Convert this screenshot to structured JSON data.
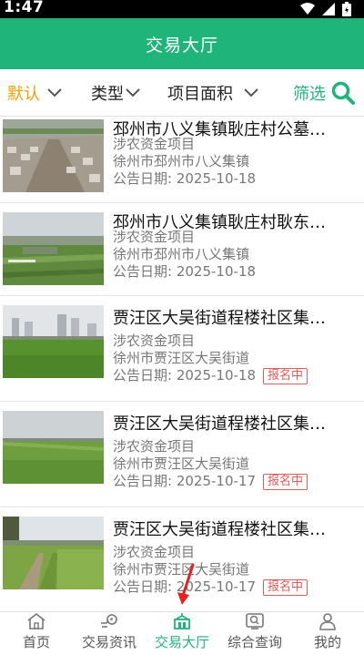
{
  "status": {
    "time": "1:47"
  },
  "header": {
    "title": "交易大厅"
  },
  "filters": {
    "default_label": "默认",
    "type_label": "类型",
    "area_label": "项目面积",
    "screen_label": "筛选"
  },
  "listings": [
    {
      "title": "邳州市八义集镇耿庄村公墓…",
      "category": "涉农资金项目",
      "location": "徐州市邳州市八义集镇",
      "date": "公告日期: 2025-10-18",
      "badge": ""
    },
    {
      "title": "邳州市八义集镇耿庄村耿东…",
      "category": "涉农资金项目",
      "location": "徐州市邳州市八义集镇",
      "date": "公告日期: 2025-10-18",
      "badge": ""
    },
    {
      "title": "贾汪区大吴街道程楼社区集…",
      "category": "涉农资金项目",
      "location": "徐州市贾汪区大吴街道",
      "date": "公告日期: 2025-10-18",
      "badge": "报名中"
    },
    {
      "title": "贾汪区大吴街道程楼社区集…",
      "category": "涉农资金项目",
      "location": "徐州市贾汪区大吴街道",
      "date": "公告日期: 2025-10-17",
      "badge": "报名中"
    },
    {
      "title": "贾汪区大吴街道程楼社区集…",
      "category": "涉农资金项目",
      "location": "徐州市贾汪区大吴街道",
      "date": "公告日期: 2025-10-17",
      "badge": "报名中"
    }
  ],
  "tabs": [
    {
      "label": "首页",
      "icon": "home-icon"
    },
    {
      "label": "交易资讯",
      "icon": "news-icon"
    },
    {
      "label": "交易大厅",
      "icon": "hall-icon",
      "active": true
    },
    {
      "label": "综合查询",
      "icon": "query-icon"
    },
    {
      "label": "我的",
      "icon": "user-icon"
    }
  ],
  "colors": {
    "primary": "#1fb57a",
    "accent": "#f0a000",
    "badge": "#e85a5a"
  }
}
